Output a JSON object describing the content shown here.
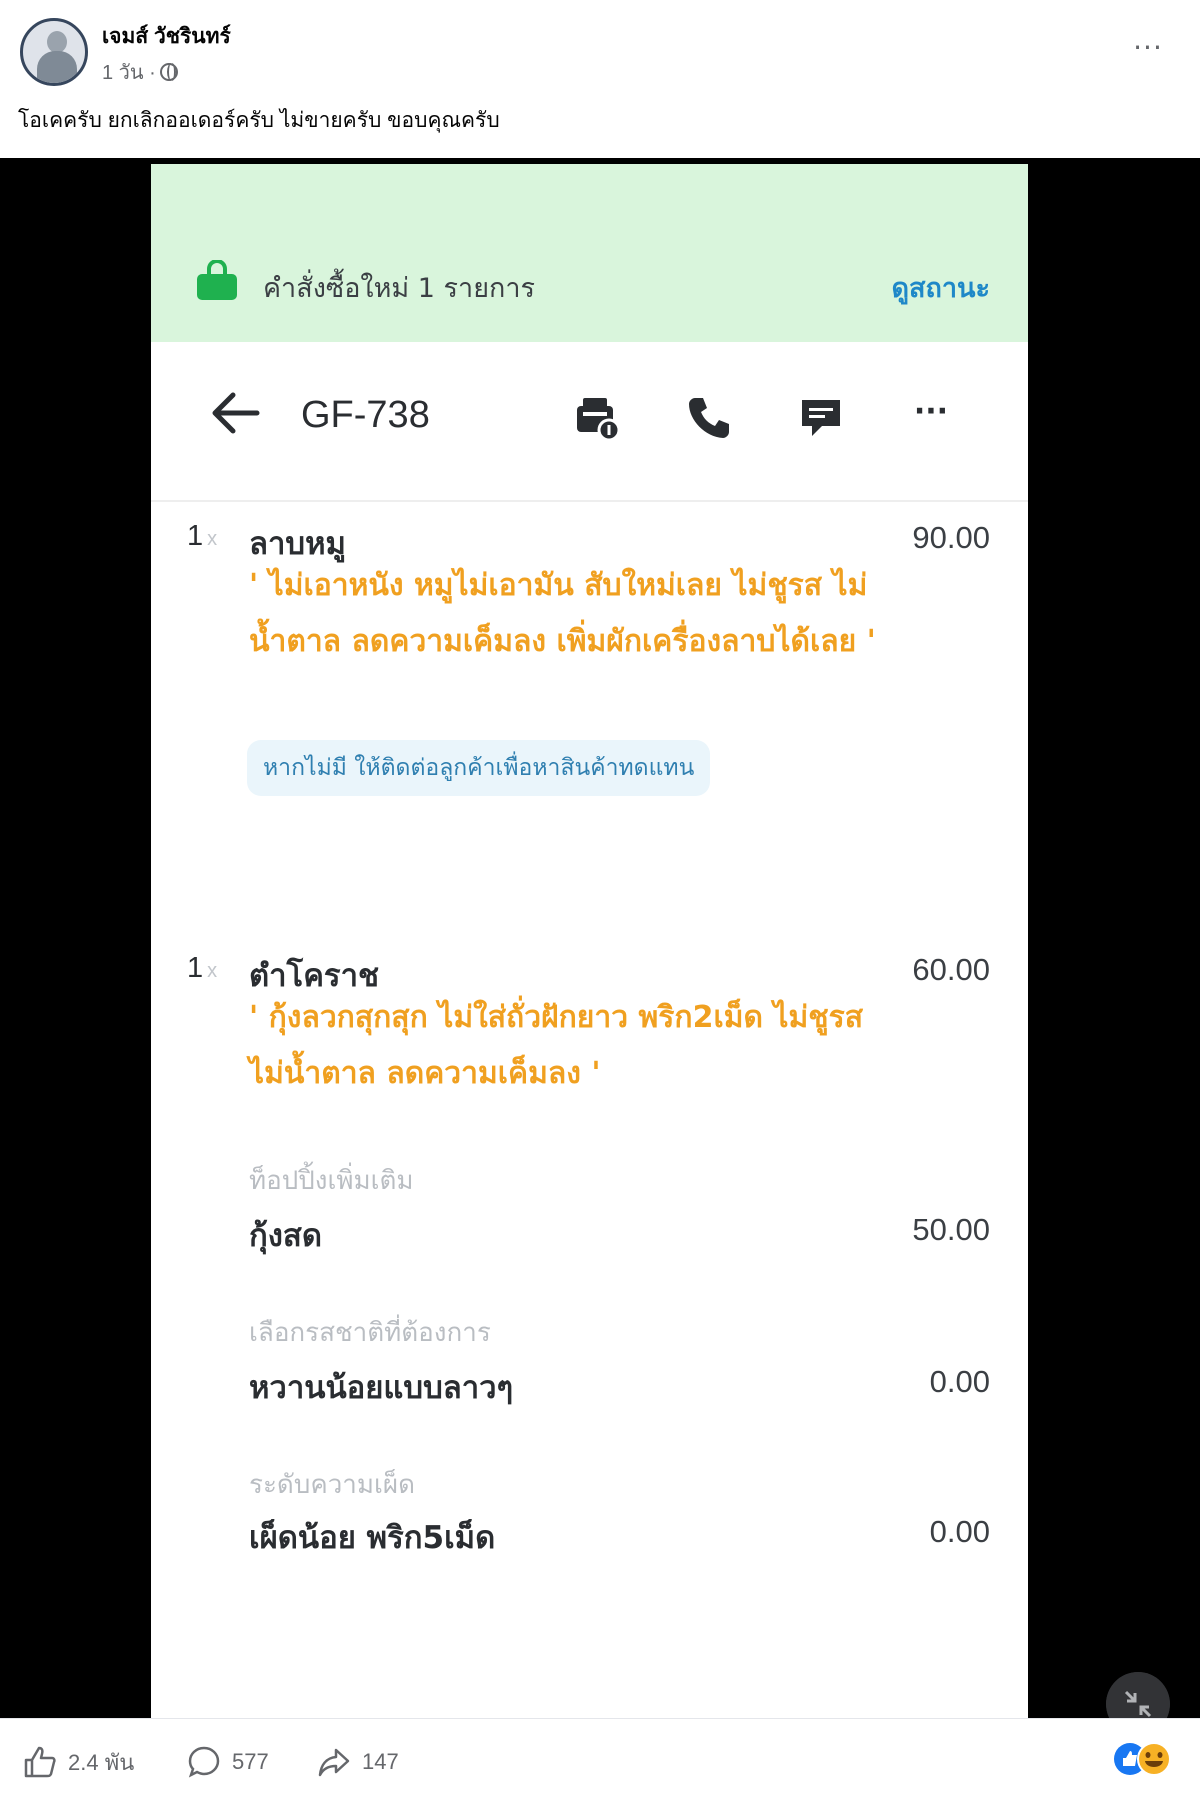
{
  "post": {
    "author": "เจมส์ วัชรินทร์",
    "time": "1 วัน ·",
    "text": "โอเคครับ ยกเลิกออเดอร์ครับ ไม่ขายครับ ขอบคุณครับ"
  },
  "app": {
    "banner_text": "คำสั่งซื้อใหม่ 1 รายการ",
    "banner_link": "ดูสถานะ",
    "order_id": "GF-738",
    "more_label": "···",
    "qty_x": "x",
    "items": [
      {
        "qty": "1",
        "name": "ลาบหมู",
        "price": "90.00",
        "note_line1": "' ไม่เอาหนัง หมูไม่เอามัน สับใหม่เลย ไม่ชูรส ไม่",
        "note_line2": "น้ำตาล ลดความเค็มลง เพิ่มผักเครื่องลาบได้เลย '",
        "hint": "หากไม่มี ให้ติดต่อลูกค้าเพื่อหาสินค้าทดแทน"
      },
      {
        "qty": "1",
        "name": "ตำโคราช",
        "price": "60.00",
        "note_line1": "' กุ้งลวกสุกสุก ไม่ใส่ถั่วฝักยาว พริก2เม็ด ไม่ชูรส",
        "note_line2": "ไม่น้ำตาล ลดความเค็มลง '",
        "options": [
          {
            "label": "ท็อปปิ้งเพิ่มเติม",
            "value": "กุ้งสด",
            "price": "50.00"
          },
          {
            "label": "เลือกรสชาติที่ต้องการ",
            "value": "หวานน้อยแบบลาวๆ",
            "price": "0.00"
          },
          {
            "label": "ระดับความเผ็ด",
            "value": "เผ็ดน้อย พริก5เม็ด",
            "price": "0.00"
          }
        ]
      }
    ]
  },
  "footer": {
    "likes": "2.4 พัน",
    "comments": "577",
    "shares": "147"
  },
  "colors": {
    "banner_bg": "#d9f5dc",
    "bag_green": "#1fb14f",
    "link_blue": "#1e88c8",
    "note_orange": "#f0a020"
  }
}
